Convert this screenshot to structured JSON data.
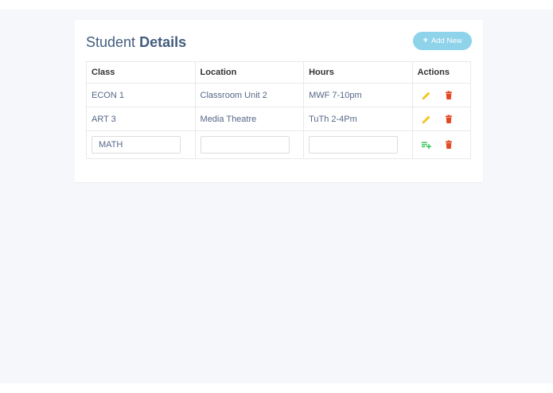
{
  "header": {
    "title_light": "Student",
    "title_bold": "Details",
    "add_button_label": "Add New",
    "add_button_icon": "plus-icon"
  },
  "table": {
    "columns": [
      "Class",
      "Location",
      "Hours",
      "Actions"
    ],
    "rows": [
      {
        "class": "ECON 1",
        "location": "Classroom Unit 2",
        "hours": "MWF 7-10pm"
      },
      {
        "class": "ART 3",
        "location": "Media Theatre",
        "hours": "TuTh 2-4Pm"
      }
    ],
    "edit_row": {
      "class": "MATH",
      "location": "",
      "hours": ""
    }
  },
  "colors": {
    "edit": "#f5c518",
    "delete": "#e34724",
    "add": "#27c24c",
    "button": "#8ed3ea"
  }
}
